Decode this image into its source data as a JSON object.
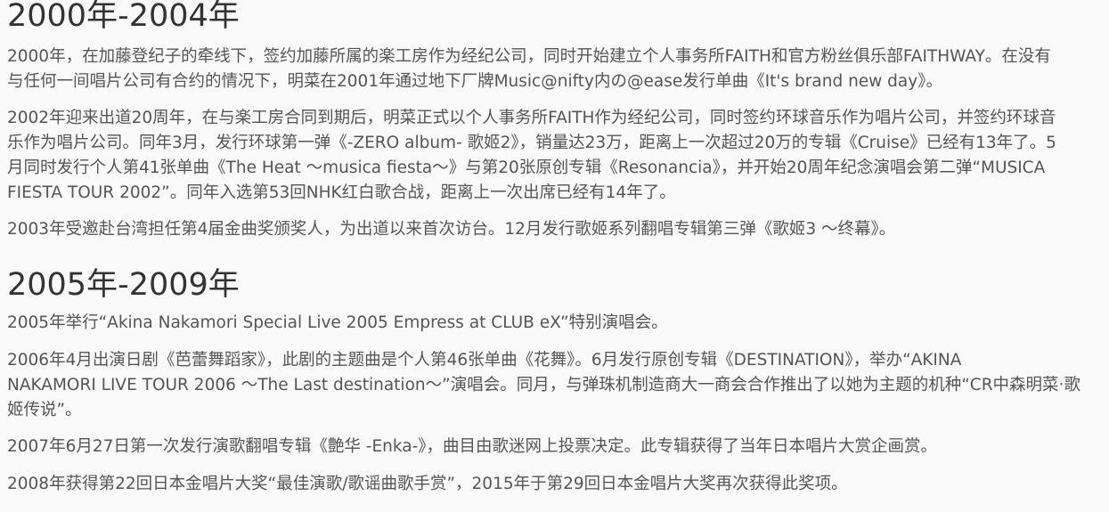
{
  "sections": [
    {
      "heading": "2000年-2004年",
      "paragraphs": [
        {
          "lines": [
            "2000年，在加藤登纪子的牵线下，签约加藤所属的楽工房作为经纪公司，同时开始建立个人事务所FAITH和官方粉丝俱乐部FAITHWAY。在没有",
            "与任何一间唱片公司有合约的情况下，明菜在2001年通过地下厂牌Music@nifty内の@ease发行单曲《It's brand new day》。"
          ]
        },
        {
          "lines": [
            "2002年迎来出道20周年，在与楽工房合同到期后，明菜正式以个人事务所FAITH作为经纪公司，同时签约环球音乐作为唱片公司，并签约环球音",
            "乐作为唱片公司。同年3月，发行环球第一弹《-ZERO album- 歌姬2》，销量达23万，距离上一次超过20万的专辑《Cruise》已经有13年了。5",
            "月同时发行个人第41张单曲《The Heat ～musica fiesta～》与第20张原创专辑《Resonancia》，并开始20周年纪念演唱会第二弹“MUSICA",
            "FIESTA TOUR 2002”。同年入选第53回NHK红白歌合战，距离上一次出席已经有14年了。"
          ]
        },
        {
          "lines": [
            "2003年受邀赴台湾担任第4届金曲奖颁奖人，为出道以来首次访台。12月发行歌姬系列翻唱专辑第三弹《歌姬3 ～终幕》。"
          ]
        }
      ]
    },
    {
      "heading": "2005年-2009年",
      "paragraphs": [
        {
          "lines": [
            "2005年举行“Akina Nakamori Special Live 2005 Empress at CLUB eX”特别演唱会。"
          ]
        },
        {
          "lines": [
            "2006年4月出演日剧《芭蕾舞蹈家》，此剧的主题曲是个人第46张单曲《花舞》。6月发行原创专辑《DESTINATION》，举办“AKINA",
            "NAKAMORI LIVE TOUR 2006 ～The Last destination～”演唱会。同月，与弹珠机制造商大一商会合作推出了以她为主题的机种“CR中森明菜·歌",
            "姬传说”。"
          ]
        },
        {
          "lines": [
            "2007年6月27日第一次发行演歌翻唱专辑《艶华 -Enka-》，曲目由歌迷网上投票决定。此专辑获得了当年日本唱片大赏企画赏。"
          ]
        },
        {
          "lines": [
            "2008年获得第22回日本金唱片大奖“最佳演歌/歌谣曲歌手赏”，2015年于第29回日本金唱片大奖再次获得此奖项。"
          ]
        }
      ]
    }
  ]
}
